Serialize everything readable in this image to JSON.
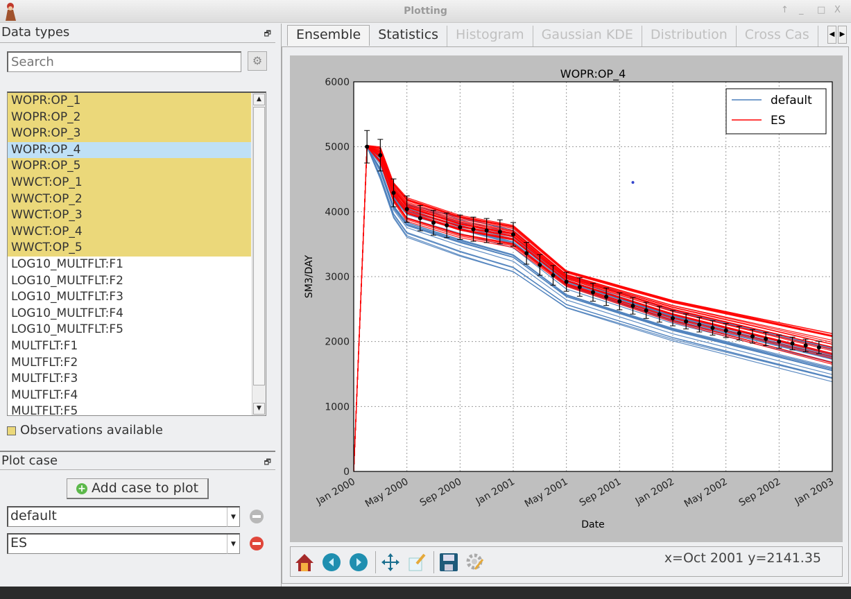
{
  "window": {
    "title": "Plotting"
  },
  "data_types": {
    "header": "Data types",
    "search_placeholder": "Search",
    "items": [
      {
        "label": "WOPR:OP_1",
        "state": "observations"
      },
      {
        "label": "WOPR:OP_2",
        "state": "observations"
      },
      {
        "label": "WOPR:OP_3",
        "state": "observations"
      },
      {
        "label": "WOPR:OP_4",
        "state": "selected"
      },
      {
        "label": "WOPR:OP_5",
        "state": "observations"
      },
      {
        "label": "WWCT:OP_1",
        "state": "observations"
      },
      {
        "label": "WWCT:OP_2",
        "state": "observations"
      },
      {
        "label": "WWCT:OP_3",
        "state": "observations"
      },
      {
        "label": "WWCT:OP_4",
        "state": "observations"
      },
      {
        "label": "WWCT:OP_5",
        "state": "observations"
      },
      {
        "label": "LOG10_MULTFLT:F1",
        "state": "none"
      },
      {
        "label": "LOG10_MULTFLT:F2",
        "state": "none"
      },
      {
        "label": "LOG10_MULTFLT:F3",
        "state": "none"
      },
      {
        "label": "LOG10_MULTFLT:F4",
        "state": "none"
      },
      {
        "label": "LOG10_MULTFLT:F5",
        "state": "none"
      },
      {
        "label": "MULTFLT:F1",
        "state": "none"
      },
      {
        "label": "MULTFLT:F2",
        "state": "none"
      },
      {
        "label": "MULTFLT:F3",
        "state": "none"
      },
      {
        "label": "MULTFLT:F4",
        "state": "none"
      },
      {
        "label": "MULTFLT:F5",
        "state": "none"
      }
    ],
    "legend_label": "Observations available",
    "colors": {
      "observations": "#ebd87a",
      "selected": "#bfe0f6"
    }
  },
  "plot_case": {
    "header": "Plot case",
    "add_label": "Add case to plot",
    "cases": [
      {
        "value": "default",
        "removable": false
      },
      {
        "value": "ES",
        "removable": true
      }
    ]
  },
  "tabs": [
    {
      "label": "Ensemble",
      "state": "active"
    },
    {
      "label": "Statistics",
      "state": "enabled"
    },
    {
      "label": "Histogram",
      "state": "disabled"
    },
    {
      "label": "Gaussian KDE",
      "state": "disabled"
    },
    {
      "label": "Distribution",
      "state": "disabled"
    },
    {
      "label": "Cross Cas",
      "state": "disabled"
    }
  ],
  "toolbar": {
    "icons": [
      "home-icon",
      "back-icon",
      "forward-icon",
      "pan-icon",
      "configure-subplots-icon",
      "save-icon",
      "customize-icon"
    ],
    "coordinates": "x=Oct 2001 y=2141.35"
  },
  "chart_data": {
    "type": "line",
    "title": "WOPR:OP_4",
    "xlabel": "Date",
    "ylabel": "SM3/DAY",
    "xlim": [
      "2000-01",
      "2003-01"
    ],
    "ylim": [
      0,
      6000
    ],
    "xticks": [
      "Jan 2000",
      "May 2000",
      "Sep 2000",
      "Jan 2001",
      "May 2001",
      "Sep 2001",
      "Jan 2002",
      "May 2002",
      "Sep 2002",
      "Jan 2003"
    ],
    "yticks": [
      0,
      1000,
      2000,
      3000,
      4000,
      5000,
      6000
    ],
    "grid": true,
    "legend_position": "top-right",
    "series": [
      {
        "name": "default",
        "color": "#4a7ebb",
        "envelope": {
          "dates": [
            "2000-01",
            "2000-02",
            "2000-03",
            "2000-04",
            "2000-05",
            "2000-09",
            "2001-01",
            "2001-05",
            "2002-01",
            "2003-01"
          ],
          "low": [
            0,
            5000,
            4500,
            3900,
            3600,
            3300,
            3050,
            2500,
            2000,
            1380
          ],
          "high": [
            0,
            5000,
            4900,
            4350,
            4150,
            3950,
            3750,
            3050,
            2500,
            1900
          ]
        }
      },
      {
        "name": "ES",
        "color": "#ff0000",
        "envelope": {
          "dates": [
            "2000-01",
            "2000-02",
            "2000-03",
            "2000-04",
            "2000-05",
            "2000-09",
            "2001-01",
            "2001-05",
            "2002-01",
            "2003-01"
          ],
          "low": [
            0,
            5000,
            4750,
            4150,
            3850,
            3600,
            3450,
            2850,
            2300,
            1650
          ],
          "high": [
            0,
            5020,
            5000,
            4450,
            4220,
            3950,
            3800,
            3100,
            2650,
            2130
          ]
        }
      }
    ],
    "observations": {
      "start": "2000-02",
      "interval": "monthly",
      "values": [
        5000,
        4870,
        4290,
        4040,
        3900,
        3830,
        3790,
        3760,
        3730,
        3710,
        3690,
        3650,
        3360,
        3180,
        3020,
        2920,
        2840,
        2760,
        2690,
        2620,
        2550,
        2480,
        2420,
        2360,
        2310,
        2260,
        2210,
        2170,
        2130,
        2080,
        2040,
        2000,
        1970,
        1940,
        1910
      ],
      "relative_error": 0.05,
      "color": "#000000"
    },
    "marker": {
      "date": "2001-10",
      "value": 4450,
      "color": "#3344cc"
    }
  }
}
